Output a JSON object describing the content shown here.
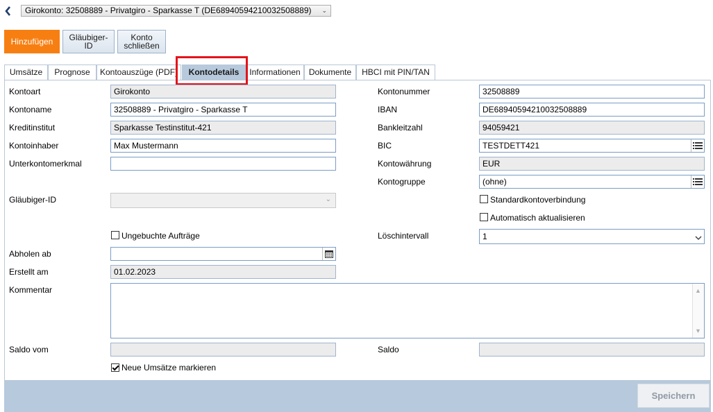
{
  "account_selector": {
    "value": "Girokonto: 32508889 - Privatgiro - Sparkasse T (DE68940594210032508889)"
  },
  "actions": {
    "add": "Hinzufügen",
    "creditor_line1": "Gläubiger-",
    "creditor_line2": "ID",
    "close_line1": "Konto",
    "close_line2": "schließen"
  },
  "tabs": [
    {
      "label": "Umsätze"
    },
    {
      "label": "Prognose"
    },
    {
      "label": "Kontoauszüge (PDF)"
    },
    {
      "label": "Kontodetails"
    },
    {
      "label": "Informationen"
    },
    {
      "label": "Dokumente"
    },
    {
      "label": "HBCI mit PIN/TAN"
    }
  ],
  "form": {
    "kontoart": {
      "label": "Kontoart",
      "value": "Girokonto"
    },
    "kontoname": {
      "label": "Kontoname",
      "value": "32508889 - Privatgiro - Sparkasse T"
    },
    "kreditinstitut": {
      "label": "Kreditinstitut",
      "value": "Sparkasse Testinstitut-421"
    },
    "kontoinhaber": {
      "label": "Kontoinhaber",
      "value": "Max Mustermann"
    },
    "unterkontomerkmal": {
      "label": "Unterkontomerkmal",
      "value": ""
    },
    "glaeubiger_id": {
      "label": "Gläubiger-ID",
      "value": ""
    },
    "ungebuchte": {
      "label": "Ungebuchte Aufträge",
      "checked": false
    },
    "abholen_ab": {
      "label": "Abholen ab",
      "value": ""
    },
    "erstellt_am": {
      "label": "Erstellt am",
      "value": "01.02.2023"
    },
    "kommentar": {
      "label": "Kommentar",
      "value": ""
    },
    "saldo_vom": {
      "label": "Saldo vom",
      "value": ""
    },
    "neue_umsaetze": {
      "label": "Neue Umsätze markieren",
      "checked": true
    },
    "kontonummer": {
      "label": "Kontonummer",
      "value": "32508889"
    },
    "iban": {
      "label": "IBAN",
      "value": "DE68940594210032508889"
    },
    "bankleitzahl": {
      "label": "Bankleitzahl",
      "value": "94059421"
    },
    "bic": {
      "label": "BIC",
      "value": "TESTDETT421"
    },
    "kontowaehrung": {
      "label": "Kontowährung",
      "value": "EUR"
    },
    "kontogruppe": {
      "label": "Kontogruppe",
      "value": "(ohne)"
    },
    "standardkonto": {
      "label": "Standardkontoverbindung",
      "checked": false
    },
    "auto_update": {
      "label": "Automatisch aktualisieren",
      "checked": false
    },
    "loeschintervall": {
      "label": "Löschintervall",
      "value": "1"
    },
    "saldo": {
      "label": "Saldo",
      "value": ""
    }
  },
  "footer": {
    "save": "Speichern"
  },
  "colors": {
    "accent": "#f77f12",
    "tab_active": "#b7c9dc",
    "highlight": "#e3141b"
  }
}
